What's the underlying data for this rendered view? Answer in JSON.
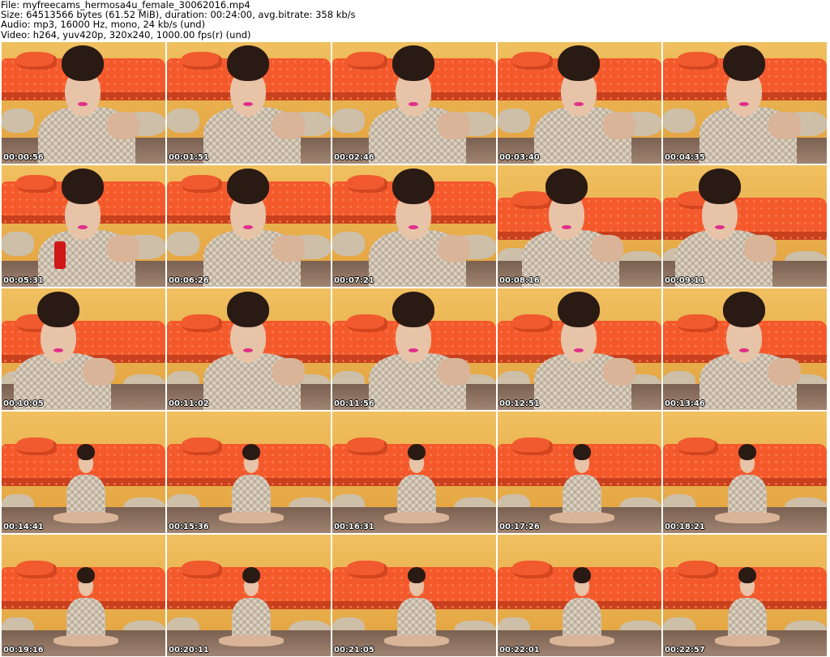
{
  "header": {
    "file": "File: myfreecams_hermosa4u_female_30062016.mp4",
    "size": "Size: 64513566 bytes (61.52 MiB), duration: 00:24:00, avg.bitrate: 358 kb/s",
    "audio": "Audio: mp3, 16000 Hz, mono, 24 kb/s (und)",
    "video": "Video: h264, yuv420p, 320x240, 1000.00 fps(r) (und)"
  },
  "thumbnails": [
    {
      "ts": "00:00:56"
    },
    {
      "ts": "00:01:51"
    },
    {
      "ts": "00:02:46"
    },
    {
      "ts": "00:03:40"
    },
    {
      "ts": "00:04:35"
    },
    {
      "ts": "00:05:31"
    },
    {
      "ts": "00:06:26"
    },
    {
      "ts": "00:07:21"
    },
    {
      "ts": "00:08:16"
    },
    {
      "ts": "00:09:11"
    },
    {
      "ts": "00:10:05"
    },
    {
      "ts": "00:11:02"
    },
    {
      "ts": "00:11:56"
    },
    {
      "ts": "00:12:51"
    },
    {
      "ts": "00:13:46"
    },
    {
      "ts": "00:14:41"
    },
    {
      "ts": "00:15:36"
    },
    {
      "ts": "00:16:31"
    },
    {
      "ts": "00:17:26"
    },
    {
      "ts": "00:18:21"
    },
    {
      "ts": "00:19:16"
    },
    {
      "ts": "00:20:11"
    },
    {
      "ts": "00:21:05"
    },
    {
      "ts": "00:22:01"
    },
    {
      "ts": "00:22:57"
    }
  ]
}
